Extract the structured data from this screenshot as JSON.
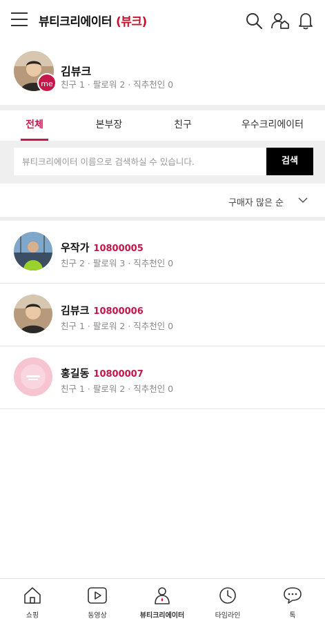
{
  "header": {
    "title": "뷰티크리에이터",
    "brand": "(뷰크)",
    "icons": [
      "menu-icon",
      "search-icon",
      "friends-home-icon",
      "bell-icon"
    ]
  },
  "profile": {
    "name": "김뷰크",
    "badge": "me",
    "stats": "친구 1 · 팔로워 2 · 직추천인 0"
  },
  "tabs": [
    {
      "label": "전체",
      "active": true
    },
    {
      "label": "본부장",
      "active": false
    },
    {
      "label": "친구",
      "active": false
    },
    {
      "label": "우수크리에이터",
      "active": false
    }
  ],
  "search": {
    "placeholder": "뷰티크리에이터 이름으로 검색하실 수 있습니다.",
    "button": "검색"
  },
  "sort": {
    "label": "구매자 많은 순"
  },
  "creators": [
    {
      "name": "우작가",
      "code": "10800005",
      "stats": "친구 2 · 팔로워 3 · 직추천인 0"
    },
    {
      "name": "김뷰크",
      "code": "10800006",
      "stats": "친구 1 · 팔로워 2 · 직추천인 0"
    },
    {
      "name": "홍길동",
      "code": "10800007",
      "stats": "친구 1 · 팔로워 2 · 직추천인 0"
    }
  ],
  "bottom_nav": [
    {
      "label": "쇼핑",
      "icon": "home-icon"
    },
    {
      "label": "동영상",
      "icon": "video-play-icon"
    },
    {
      "label": "뷰티크리에이터",
      "icon": "creator-person-icon",
      "active": true
    },
    {
      "label": "타임라인",
      "icon": "clock-icon"
    },
    {
      "label": "톡",
      "icon": "chat-bubble-icon"
    }
  ],
  "colors": {
    "accent": "#c8154a",
    "brand_red": "#c8102e",
    "search_button": "#000000",
    "background_gap": "#efefef"
  }
}
